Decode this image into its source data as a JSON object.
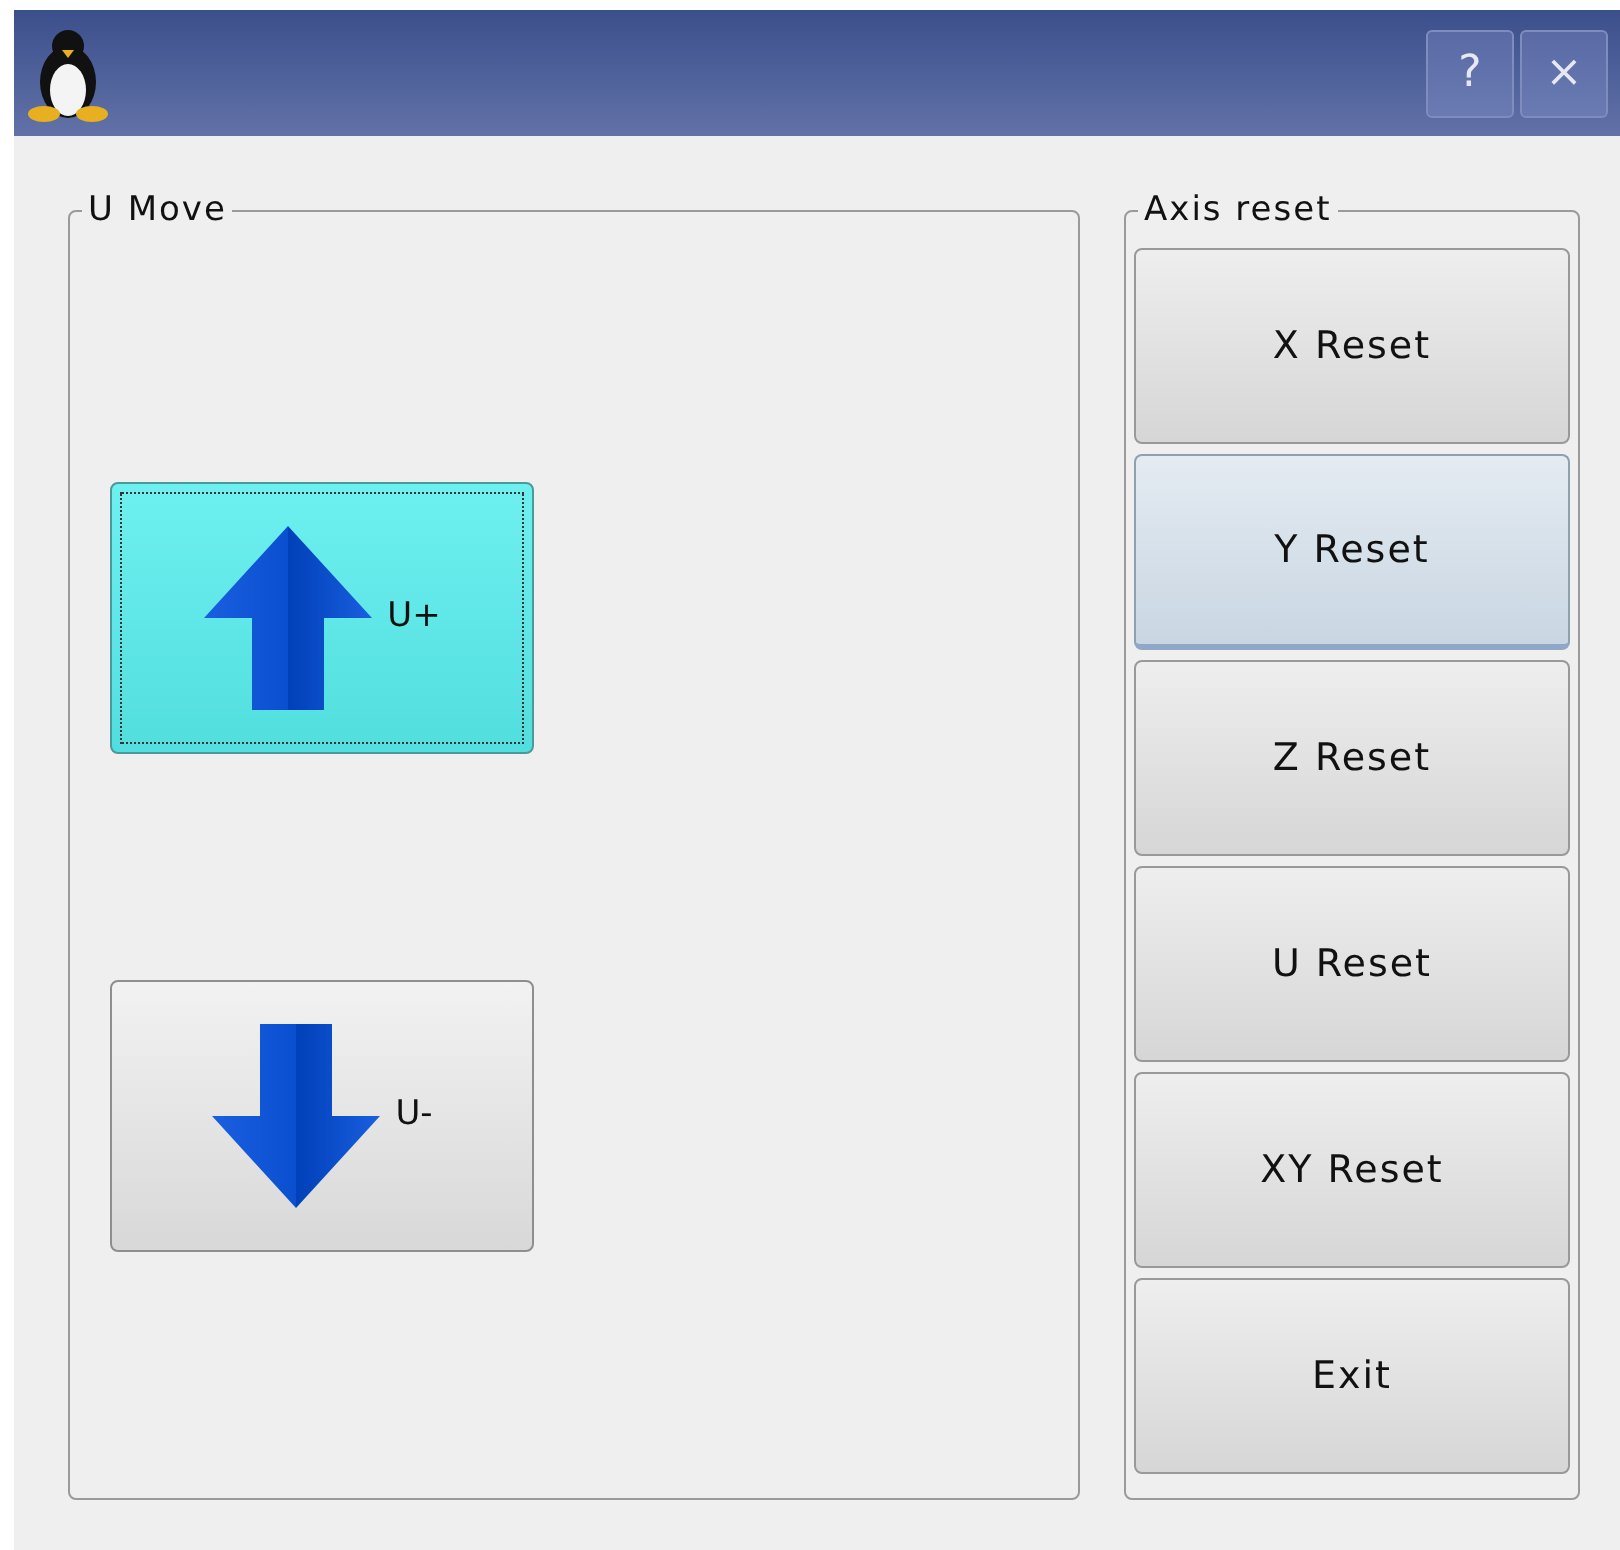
{
  "window": {
    "title_buttons": [
      "?",
      "×"
    ]
  },
  "u_move": {
    "title": "U Move",
    "buttons": [
      {
        "label": "U+",
        "kind": "up",
        "focused": true
      },
      {
        "label": "U-",
        "kind": "down",
        "focused": false
      }
    ]
  },
  "axis_reset": {
    "title": "Axis reset",
    "buttons": [
      {
        "label": "X Reset",
        "hovered": false
      },
      {
        "label": "Y Reset",
        "hovered": true
      },
      {
        "label": "Z Reset",
        "hovered": false
      },
      {
        "label": "U Reset",
        "hovered": false
      },
      {
        "label": "XY Reset",
        "hovered": false
      },
      {
        "label": "Exit",
        "hovered": false
      }
    ]
  }
}
